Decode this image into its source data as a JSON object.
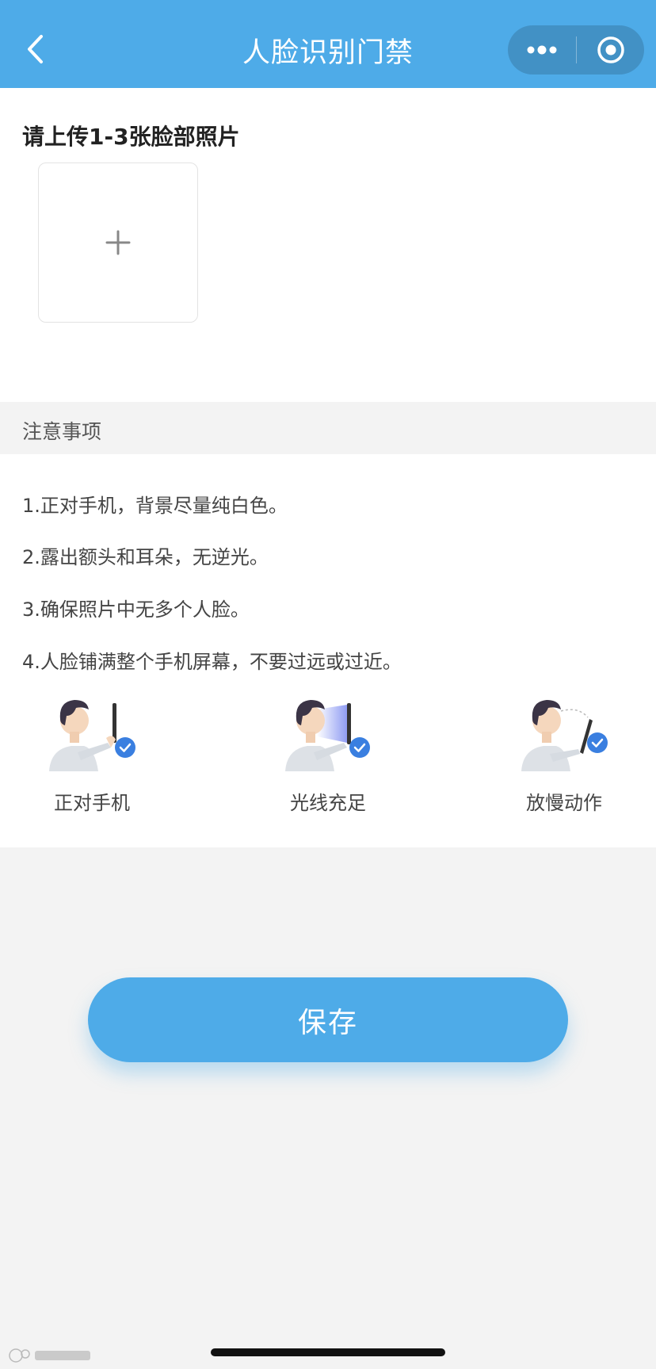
{
  "navbar": {
    "title": "人脸识别门禁",
    "back_icon": "chevron-left-icon",
    "more_icon": "more-dots-icon",
    "close_icon": "target-circle-icon",
    "bg_color": "#4eabe8"
  },
  "upload": {
    "title": "请上传1-3张脸部照片",
    "add_icon": "plus-icon"
  },
  "notes": {
    "header": "注意事项",
    "items": [
      "1.正对手机，背景尽量纯白色。",
      "2.露出额头和耳朵，无逆光。",
      "3.确保照片中无多个人脸。",
      "4.人脸铺满整个手机屏幕，不要过远或过近。"
    ],
    "tips": [
      {
        "label": "正对手机",
        "icon": "face-phone-illustration"
      },
      {
        "label": "光线充足",
        "icon": "lighting-illustration"
      },
      {
        "label": "放慢动作",
        "icon": "slow-motion-illustration"
      }
    ]
  },
  "actions": {
    "save_label": "保存"
  },
  "colors": {
    "accent": "#4eabe8",
    "check_badge": "#3a7fe0",
    "page_bg": "#f3f3f3"
  }
}
